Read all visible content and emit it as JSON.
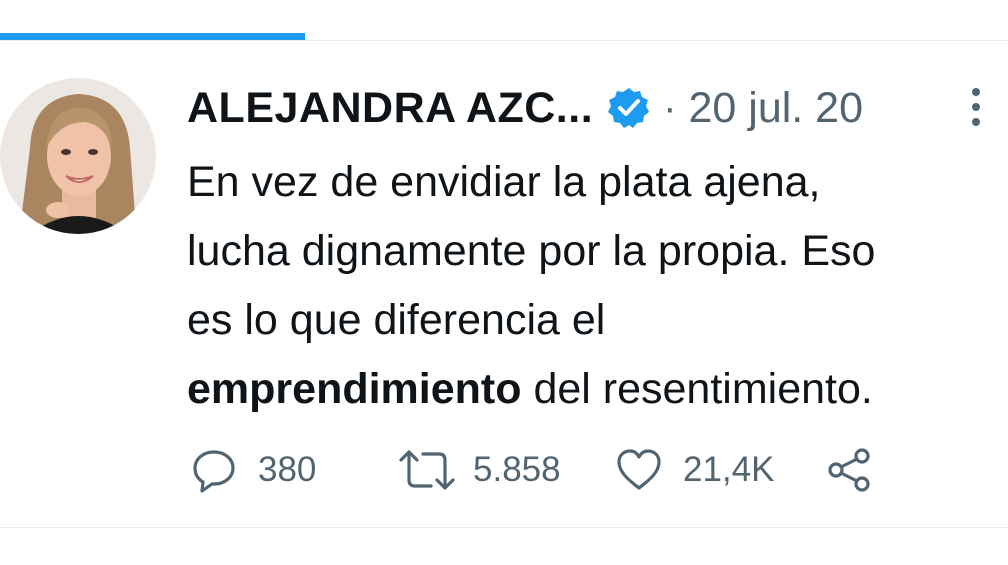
{
  "tweet": {
    "author_name": "ALEJANDRA AZC...",
    "separator": "·",
    "date": "20 jul. 20",
    "text": {
      "line1": "En vez de envidiar la plata ajena,",
      "line2": "lucha dignamente por la propia. Eso",
      "line3": "es lo que diferencia el",
      "line4_bold": "emprendimiento",
      "line4_rest": " del resentimiento."
    },
    "replies": "380",
    "retweets": "5.858",
    "likes": "21,4K"
  },
  "icons": {
    "verified": "verified-badge-icon",
    "more": "more-vertical-icon",
    "reply": "reply-icon",
    "retweet": "retweet-icon",
    "like": "heart-icon",
    "share": "share-icon"
  },
  "colors": {
    "accent": "#1d9bf0",
    "text": "#0f1419",
    "secondary": "#536471",
    "divider": "#e6ecf0"
  }
}
